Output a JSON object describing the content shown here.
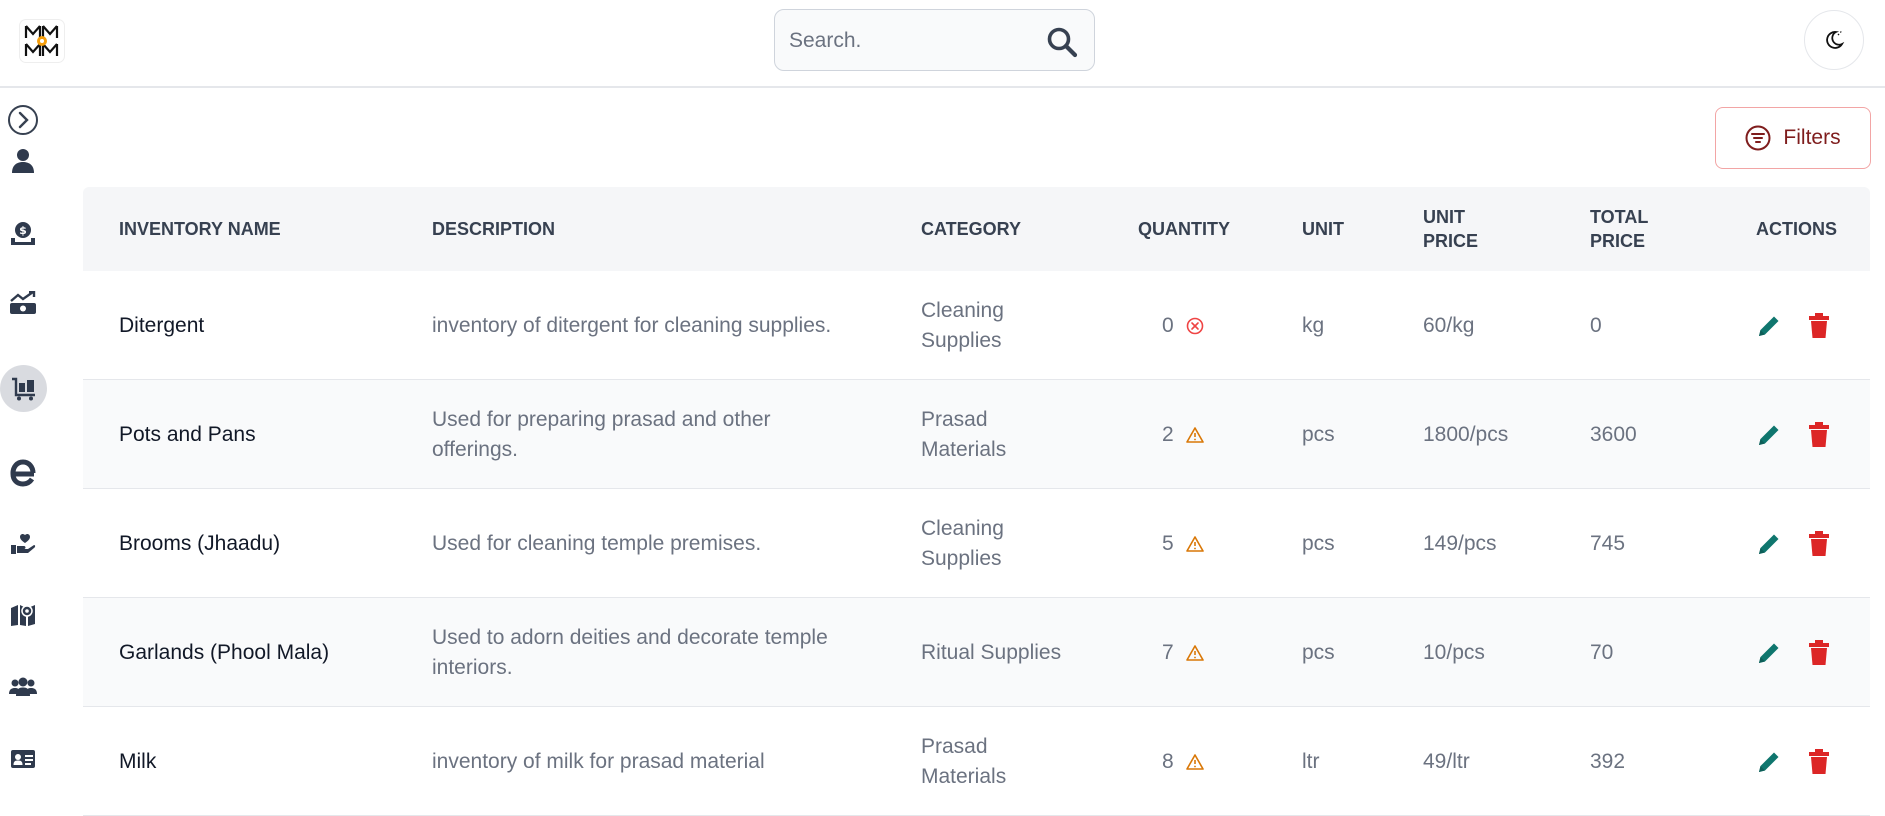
{
  "search": {
    "placeholder": "Search."
  },
  "toolbar": {
    "filters_label": "Filters"
  },
  "sidebar": {
    "items": [
      {
        "icon": "chevron-right-circle-icon"
      },
      {
        "icon": "user-icon"
      },
      {
        "icon": "donation-icon"
      },
      {
        "icon": "finance-chart-icon"
      },
      {
        "icon": "inventory-cart-icon",
        "active": true
      },
      {
        "icon": "e-logo-icon"
      },
      {
        "icon": "hand-heart-icon"
      },
      {
        "icon": "map-icon"
      },
      {
        "icon": "users-group-icon"
      },
      {
        "icon": "id-card-icon"
      }
    ]
  },
  "table": {
    "headers": {
      "name": "INVENTORY NAME",
      "description": "DESCRIPTION",
      "category": "CATEGORY",
      "quantity": "QUANTITY",
      "unit": "UNIT",
      "unit_price_1": "UNIT",
      "unit_price_2": "PRICE",
      "total_price_1": "TOTAL",
      "total_price_2": "PRICE",
      "actions": "ACTIONS"
    },
    "rows": [
      {
        "name": "Ditergent",
        "description_1": "inventory of ditergent for cleaning supplies.",
        "description_2": "",
        "category_1": "Cleaning",
        "category_2": "Supplies",
        "quantity": "0",
        "status": "out-of-stock",
        "unit": "kg",
        "unit_price": "60/kg",
        "total_price": "0"
      },
      {
        "name": "Pots and Pans",
        "description_1": "Used for preparing prasad and other",
        "description_2": "offerings.",
        "category_1": "Prasad",
        "category_2": "Materials",
        "quantity": "2",
        "status": "low-stock",
        "unit": "pcs",
        "unit_price": "1800/pcs",
        "total_price": "3600"
      },
      {
        "name": "Brooms (Jhaadu)",
        "description_1": "Used for cleaning temple premises.",
        "description_2": "",
        "category_1": "Cleaning",
        "category_2": "Supplies",
        "quantity": "5",
        "status": "low-stock",
        "unit": "pcs",
        "unit_price": "149/pcs",
        "total_price": "745"
      },
      {
        "name": "Garlands (Phool Mala)",
        "description_1": "Used to adorn deities and decorate temple",
        "description_2": "interiors.",
        "category_1": "Ritual Supplies",
        "category_2": "",
        "quantity": "7",
        "status": "low-stock",
        "unit": "pcs",
        "unit_price": "10/pcs",
        "total_price": "70"
      },
      {
        "name": "Milk",
        "description_1": "inventory of milk for prasad material",
        "description_2": "",
        "category_1": "Prasad",
        "category_2": "Materials",
        "quantity": "8",
        "status": "low-stock",
        "unit": "ltr",
        "unit_price": "49/ltr",
        "total_price": "392"
      }
    ]
  },
  "colors": {
    "edit": "#0f766e",
    "delete": "#dc2626",
    "warning": "#d97706",
    "error": "#ef4444",
    "filters": "#7f1d1d"
  }
}
